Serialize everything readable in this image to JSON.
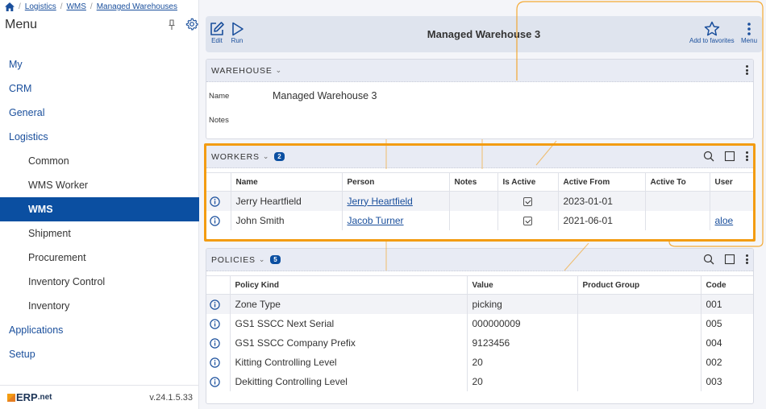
{
  "breadcrumb": {
    "items": [
      "Logistics",
      "WMS",
      "Managed Warehouses"
    ]
  },
  "sidebar": {
    "title": "Menu",
    "items": [
      {
        "label": "My",
        "level": 0,
        "active": false
      },
      {
        "label": "CRM",
        "level": 0,
        "active": false
      },
      {
        "label": "General",
        "level": 0,
        "active": false
      },
      {
        "label": "Logistics",
        "level": 0,
        "active": false
      },
      {
        "label": "Common",
        "level": 1,
        "active": false
      },
      {
        "label": "WMS Worker",
        "level": 1,
        "active": false
      },
      {
        "label": "WMS",
        "level": 1,
        "active": true
      },
      {
        "label": "Shipment",
        "level": 1,
        "active": false
      },
      {
        "label": "Procurement",
        "level": 1,
        "active": false
      },
      {
        "label": "Inventory Control",
        "level": 1,
        "active": false
      },
      {
        "label": "Inventory",
        "level": 1,
        "active": false
      },
      {
        "label": "Applications",
        "level": 0,
        "active": false
      },
      {
        "label": "Setup",
        "level": 0,
        "active": false
      }
    ],
    "logo_main": "ERP",
    "logo_suffix": ".net",
    "version": "v.24.1.5.33"
  },
  "toolbar": {
    "edit_label": "Edit",
    "run_label": "Run",
    "title": "Managed Warehouse 3",
    "favorites_label": "Add to favorites",
    "menu_label": "Menu"
  },
  "warehouse": {
    "header": "WAREHOUSE",
    "name_label": "Name",
    "name_value": "Managed Warehouse 3",
    "notes_label": "Notes",
    "notes_value": ""
  },
  "workers": {
    "header": "WORKERS",
    "count": "2",
    "columns": [
      "Name",
      "Person",
      "Notes",
      "Is Active",
      "Active From",
      "Active To",
      "User"
    ],
    "rows": [
      {
        "name": "Jerry Heartfield",
        "person": "Jerry Heartfield",
        "notes": "",
        "is_active": true,
        "active_from": "2023-01-01",
        "active_to": "",
        "user": ""
      },
      {
        "name": "John Smith",
        "person": "Jacob Turner",
        "notes": "",
        "is_active": true,
        "active_from": "2021-06-01",
        "active_to": "",
        "user": "aloe"
      }
    ]
  },
  "policies": {
    "header": "POLICIES",
    "count": "5",
    "columns": [
      "Policy Kind",
      "Value",
      "Product Group",
      "Code"
    ],
    "rows": [
      {
        "kind": "Zone Type",
        "value": "picking",
        "product_group": "",
        "code": "001"
      },
      {
        "kind": "GS1 SSCC Next Serial",
        "value": "000000009",
        "product_group": "",
        "code": "005"
      },
      {
        "kind": "GS1 SSCC Company Prefix",
        "value": "9123456",
        "product_group": "",
        "code": "004"
      },
      {
        "kind": "Kitting Controlling Level",
        "value": "20",
        "product_group": "",
        "code": "002"
      },
      {
        "kind": "Dekitting Controlling Level",
        "value": "20",
        "product_group": "",
        "code": "003"
      }
    ]
  },
  "colors": {
    "accent": "#0b4fa1",
    "highlight": "#f39c12",
    "link": "#1a4f9c"
  }
}
